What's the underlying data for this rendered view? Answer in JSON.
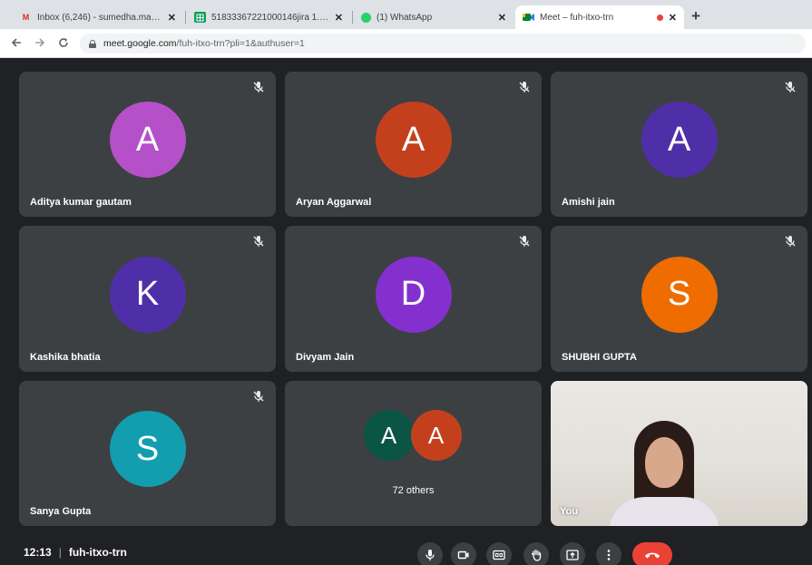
{
  "browser": {
    "tabs": [
      {
        "label": "Inbox (6,246) - sumedha.maims@",
        "favicon": "gmail-icon",
        "favicon_text": "M",
        "favicon_color": "#d93025"
      },
      {
        "label": "51833367221000146jira 1..17",
        "favicon": "sheets-icon",
        "favicon_text": "",
        "favicon_color": "#0f9d58"
      },
      {
        "label": "(1) WhatsApp",
        "favicon": "whatsapp-icon",
        "favicon_text": "",
        "favicon_color": "#25d366"
      },
      {
        "label": "Meet – fuh-itxo-trn",
        "favicon": "meet-icon",
        "favicon_text": "",
        "favicon_color": "#00832d",
        "active": true,
        "recording": true
      }
    ],
    "new_tab_label": "+",
    "close_label": "✕",
    "url_domain": "meet.google.com",
    "url_path": "/fuh-itxo-trn?pli=1&authuser=1"
  },
  "participants": [
    {
      "name": "Aditya kumar gautam",
      "initial": "A",
      "color": "#b550c8",
      "muted": true
    },
    {
      "name": "Aryan Aggarwal",
      "initial": "A",
      "color": "#c4401d",
      "muted": true
    },
    {
      "name": "Amishi jain",
      "initial": "A",
      "color": "#4f2fa8",
      "muted": true
    },
    {
      "name": "Kashika bhatia",
      "initial": "K",
      "color": "#4f2fa8",
      "muted": true
    },
    {
      "name": "Divyam Jain",
      "initial": "D",
      "color": "#8430ce",
      "muted": true
    },
    {
      "name": "SHUBHI GUPTA",
      "initial": "S",
      "color": "#ef6c00",
      "muted": true
    },
    {
      "name": "Sanya Gupta",
      "initial": "S",
      "color": "#129eaf",
      "muted": true
    }
  ],
  "others": {
    "label": "72 others",
    "avatars": [
      {
        "initial": "A",
        "color": "#0b5545"
      },
      {
        "initial": "A",
        "color": "#c4401d"
      }
    ]
  },
  "self": {
    "label": "You"
  },
  "meeting": {
    "time": "12:13",
    "divider": "|",
    "code": "fuh-itxo-trn"
  },
  "controls": [
    "microphone-icon",
    "camera-icon",
    "captions-icon",
    "raise-hand-icon",
    "present-icon",
    "more-options-icon",
    "hang-up-icon"
  ]
}
